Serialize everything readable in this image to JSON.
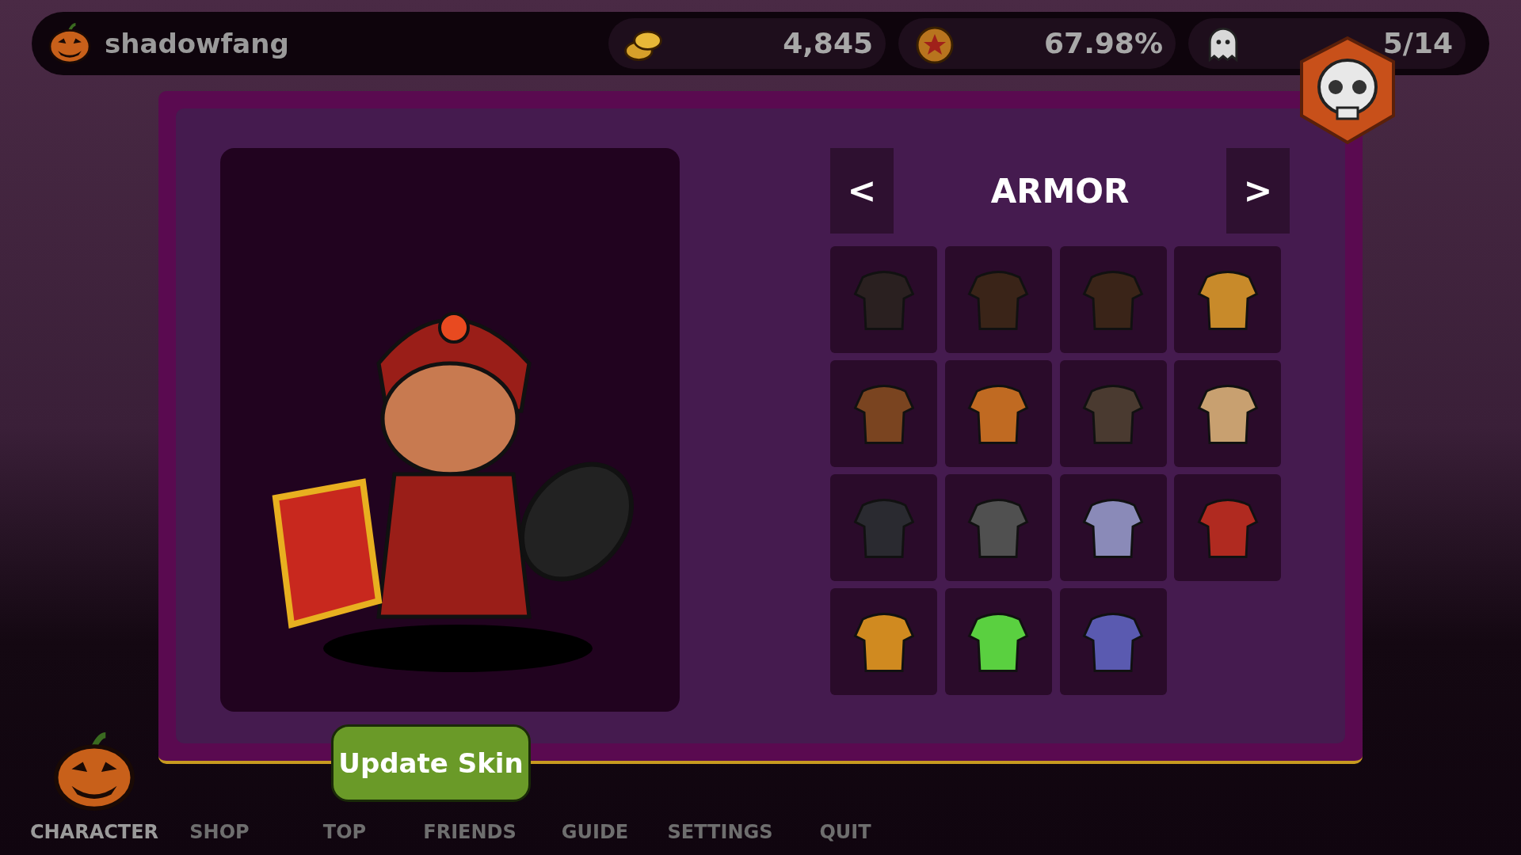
{
  "top_bar": {
    "username": "shadowfang",
    "coins": "4,845",
    "rank": "67.98%",
    "ghosts": "5/14"
  },
  "armor_panel": {
    "title": "ARMOR",
    "prev": "<",
    "next": ">",
    "items": [
      {
        "color": "#2a2020"
      },
      {
        "color": "#3a2418"
      },
      {
        "color": "#3a2418"
      },
      {
        "color": "#c88a2a"
      },
      {
        "color": "#7a4420"
      },
      {
        "color": "#c06a22"
      },
      {
        "color": "#4a3a30"
      },
      {
        "color": "#c8a070"
      },
      {
        "color": "#2a2a30"
      },
      {
        "color": "#505050"
      },
      {
        "color": "#8a8ab8"
      },
      {
        "color": "#b02a20"
      },
      {
        "color": "#d08a20"
      },
      {
        "color": "#5ad040"
      },
      {
        "color": "#5a5ab0"
      }
    ]
  },
  "update_button": "Update Skin",
  "nav": [
    {
      "label": "CHARACTER",
      "selected": true
    },
    {
      "label": "SHOP",
      "selected": false
    },
    {
      "label": "TOP",
      "selected": false
    },
    {
      "label": "FRIENDS",
      "selected": false
    },
    {
      "label": "GUIDE",
      "selected": false
    },
    {
      "label": "SETTINGS",
      "selected": false
    },
    {
      "label": "QUIT",
      "selected": false
    }
  ]
}
